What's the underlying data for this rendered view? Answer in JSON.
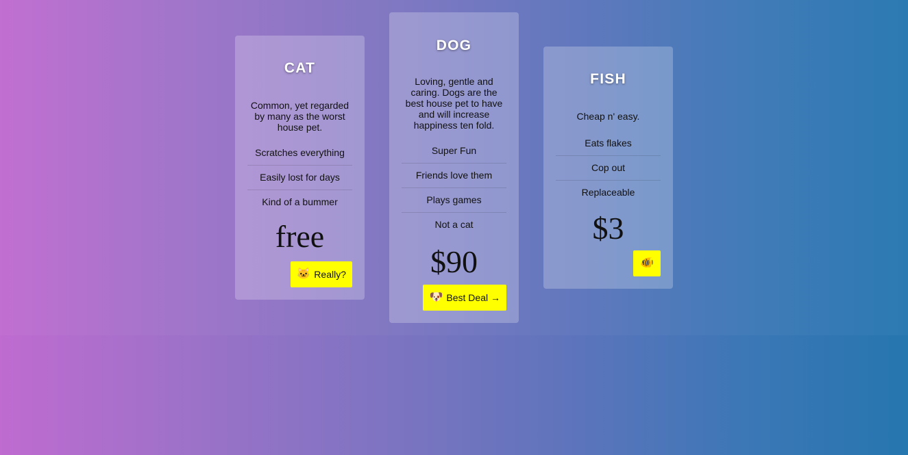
{
  "cards": [
    {
      "title": "CAT",
      "description": "Common, yet regarded by many as the worst house pet.",
      "features": [
        "Scratches everything",
        "Easily lost for days",
        "Kind of a bummer"
      ],
      "price": "free",
      "button": {
        "icon": "cat-face-icon",
        "emoji": "🐱",
        "label": "Really?"
      }
    },
    {
      "title": "DOG",
      "description": "Loving, gentle and caring. Dogs are the best house pet to have and will increase happiness ten fold.",
      "features": [
        "Super Fun",
        "Friends love them",
        "Plays games",
        "Not a cat"
      ],
      "price": "$90",
      "button": {
        "icon": "dog-face-icon",
        "emoji": "🐶",
        "label": "Best Deal →"
      }
    },
    {
      "title": "FISH",
      "description": "Cheap n' easy.",
      "features": [
        "Eats flakes",
        "Cop out",
        "Replaceable"
      ],
      "price": "$3",
      "button": {
        "icon": "fish-icon",
        "emoji": "🐠",
        "label": ""
      }
    }
  ],
  "colors": {
    "gradient_left": "#bf6bd0",
    "gradient_right": "#2676b0",
    "button_background": "#ffff00",
    "title_text": "#ffffff"
  }
}
